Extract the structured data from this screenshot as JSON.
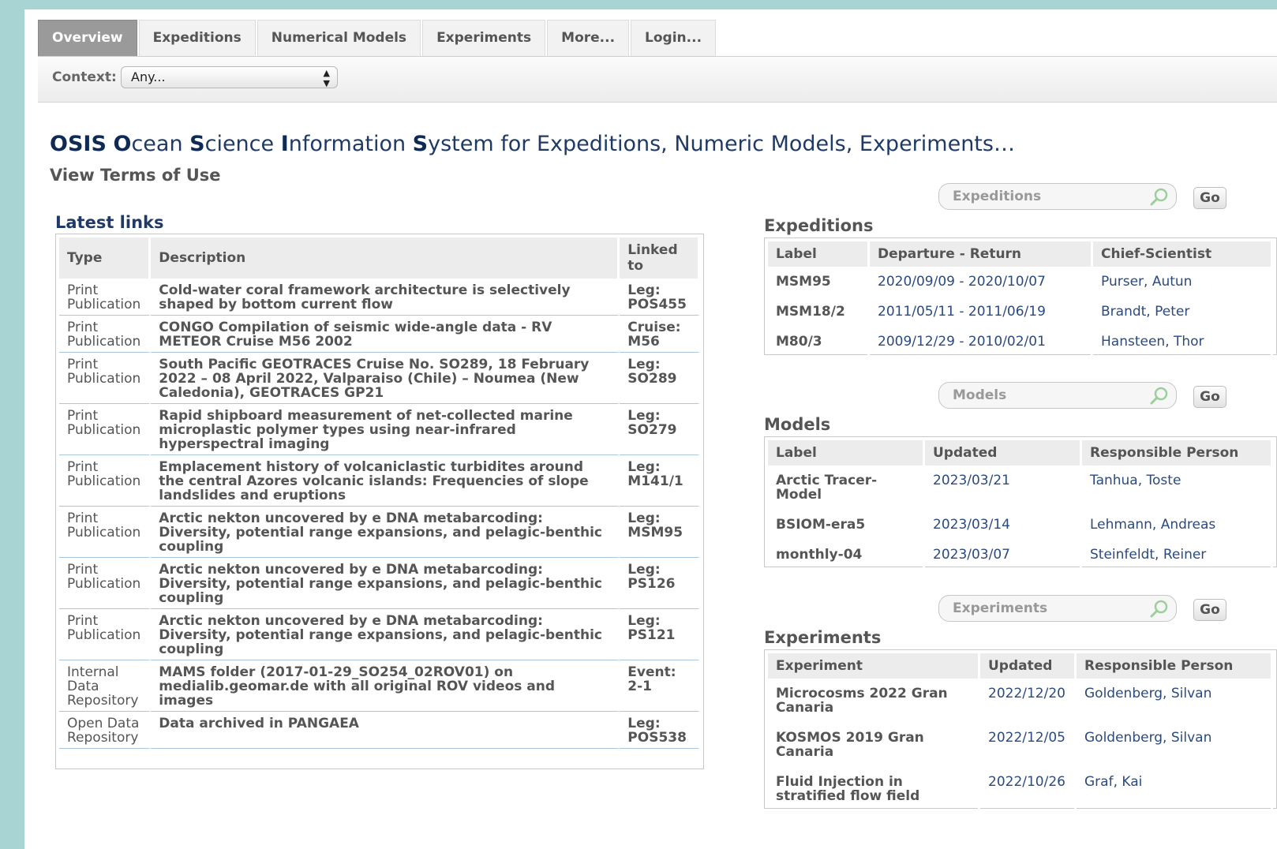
{
  "tabs": [
    "Overview",
    "Expeditions",
    "Numerical Models",
    "Experiments",
    "More...",
    "Login..."
  ],
  "context": {
    "label": "Context:",
    "value": "Any..."
  },
  "title": {
    "parts": [
      {
        "bold": "OSIS",
        "rest": " "
      },
      {
        "bold": "O",
        "rest": "cean "
      },
      {
        "bold": "S",
        "rest": "cience "
      },
      {
        "bold": "I",
        "rest": "nformation "
      },
      {
        "bold": "S",
        "rest": "ystem for Expeditions, Numeric Models, Experiments…"
      }
    ]
  },
  "terms_link": "View Terms of Use",
  "latest_links": {
    "title": "Latest links",
    "headers": [
      "Type",
      "Description",
      "Linked to"
    ],
    "rows": [
      {
        "type": "Print Publication",
        "description": "Cold-water coral framework architecture is selectively shaped by bottom current flow",
        "linked": "Leg: POS455"
      },
      {
        "type": "Print Publication",
        "description": "CONGO Compilation of seismic wide-angle data - RV METEOR Cruise M56 2002",
        "linked": "Cruise: M56"
      },
      {
        "type": "Print Publication",
        "description": "South Pacific GEOTRACES Cruise No. SO289, 18 February 2022 – 08 April 2022, Valparaiso (Chile) – Noumea (New Caledonia), GEOTRACES GP21",
        "linked": "Leg: SO289"
      },
      {
        "type": "Print Publication",
        "description": "Rapid shipboard measurement of net-collected marine microplastic polymer types using near-infrared hyperspectral imaging",
        "linked": "Leg: SO279"
      },
      {
        "type": "Print Publication",
        "description": "Emplacement history of volcaniclastic turbidites around the central Azores volcanic islands: Frequencies of slope landslides and eruptions",
        "linked": "Leg: M141/1"
      },
      {
        "type": "Print Publication",
        "description": "Arctic nekton uncovered by e DNA metabarcoding: Diversity, potential range expansions, and pelagic-benthic coupling",
        "linked": "Leg: MSM95"
      },
      {
        "type": "Print Publication",
        "description": "Arctic nekton uncovered by e DNA metabarcoding: Diversity, potential range expansions, and pelagic-benthic coupling",
        "linked": "Leg: PS126"
      },
      {
        "type": "Print Publication",
        "description": "Arctic nekton uncovered by e DNA metabarcoding: Diversity, potential range expansions, and pelagic-benthic coupling",
        "linked": "Leg: PS121"
      },
      {
        "type": "Internal Data Repository",
        "description": "MAMS folder (2017-01-29_SO254_02ROV01) on medialib.geomar.de with all original ROV videos and images",
        "linked": "Event: 2-1"
      },
      {
        "type": "Open Data Repository",
        "description": "Data archived in PANGAEA",
        "linked": "Leg: POS538"
      }
    ]
  },
  "expeditions": {
    "search_placeholder": "Expeditions",
    "go": "Go",
    "title": "Expeditions",
    "headers": [
      "Label",
      "Departure - Return",
      "Chief-Scientist"
    ],
    "rows": [
      [
        "MSM95",
        "2020/09/09 - 2020/10/07",
        "Purser, Autun"
      ],
      [
        "MSM18/2",
        "2011/05/11 - 2011/06/19",
        "Brandt, Peter"
      ],
      [
        "M80/3",
        "2009/12/29 - 2010/02/01",
        "Hansteen, Thor"
      ]
    ]
  },
  "models": {
    "search_placeholder": "Models",
    "go": "Go",
    "title": "Models",
    "headers": [
      "Label",
      "Updated",
      "Responsible Person"
    ],
    "rows": [
      [
        "Arctic Tracer-Model",
        "2023/03/21",
        "Tanhua, Toste"
      ],
      [
        "BSIOM-era5",
        "2023/03/14",
        "Lehmann, Andreas"
      ],
      [
        "monthly-04",
        "2023/03/07",
        "Steinfeldt, Reiner"
      ]
    ]
  },
  "experiments": {
    "search_placeholder": "Experiments",
    "go": "Go",
    "title": "Experiments",
    "headers": [
      "Experiment",
      "Updated",
      "Responsible Person"
    ],
    "rows": [
      [
        "Microcosms 2022 Gran Canaria",
        "2022/12/20",
        "Goldenberg, Silvan"
      ],
      [
        "KOSMOS 2019 Gran Canaria",
        "2022/12/05",
        "Goldenberg, Silvan"
      ],
      [
        "Fluid Injection in stratified flow field",
        "2022/10/26",
        "Graf, Kai"
      ]
    ]
  }
}
